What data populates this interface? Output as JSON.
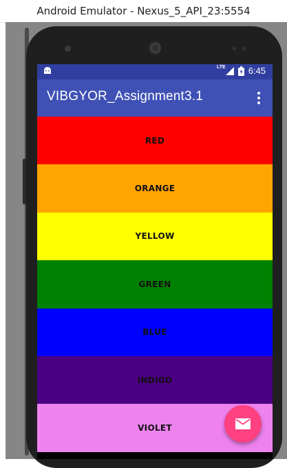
{
  "window": {
    "title": "Android Emulator - Nexus_5_API_23:5554"
  },
  "status_bar": {
    "time": "6:45",
    "network": "LTE",
    "background": "#303f9f"
  },
  "app_bar": {
    "title": "VIBGYOR_Assignment3.1",
    "background": "#3f51b5"
  },
  "colors": [
    {
      "label": "RED",
      "color": "#ff0000"
    },
    {
      "label": "ORANGE",
      "color": "#ffa500"
    },
    {
      "label": "YELLOW",
      "color": "#ffff00"
    },
    {
      "label": "GREEN",
      "color": "#008000"
    },
    {
      "label": "BLUE",
      "color": "#0000ff"
    },
    {
      "label": "INDIGO",
      "color": "#4b0082"
    },
    {
      "label": "VIOLET",
      "color": "#ee82ee"
    }
  ],
  "fab": {
    "icon": "email-icon",
    "color": "#ff4081"
  }
}
